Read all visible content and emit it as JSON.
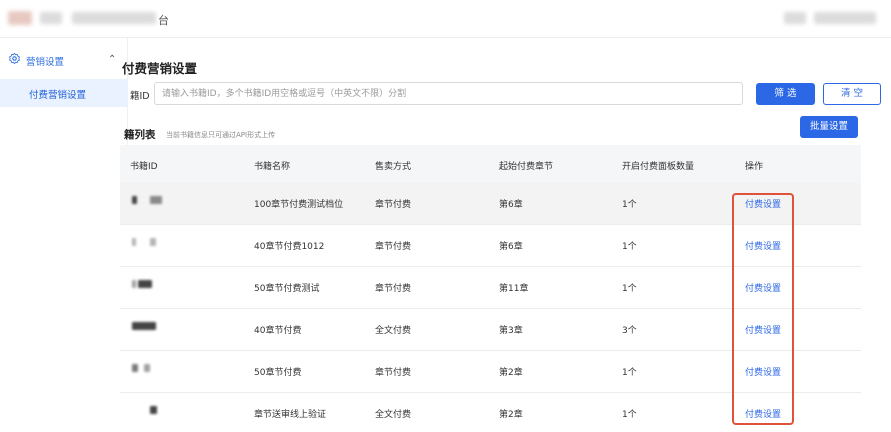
{
  "header": {
    "title_tail": "台"
  },
  "sidebar": {
    "group_label": "营销设置",
    "sub_item_label": "付费营销设置"
  },
  "page": {
    "title": "付费营销设置"
  },
  "filter": {
    "label": "籍ID",
    "placeholder": "请输入书籍ID，多个书籍ID用空格或逗号（中英文不限）分割",
    "value": "",
    "filter_button": "筛 选",
    "clear_button": "清 空"
  },
  "section": {
    "title": "籍列表",
    "subtitle": "当前书籍信息只可通过API形式上传",
    "batch_button": "批量设置"
  },
  "table": {
    "headers": [
      "书籍ID",
      "书籍名称",
      "售卖方式",
      "起始付费章节",
      "开启付费面板数量",
      "操作"
    ],
    "rows": [
      {
        "name": "100章节付费测试档位",
        "sale": "章节付费",
        "start": "第6章",
        "count": "1个",
        "action": "付费设置"
      },
      {
        "name": "40章节付费1012",
        "sale": "章节付费",
        "start": "第6章",
        "count": "1个",
        "action": "付费设置"
      },
      {
        "name": "50章节付费测试",
        "sale": "章节付费",
        "start": "第11章",
        "count": "1个",
        "action": "付费设置"
      },
      {
        "name": "40章节付费",
        "sale": "全文付费",
        "start": "第3章",
        "count": "3个",
        "action": "付费设置"
      },
      {
        "name": "50章节付费",
        "sale": "章节付费",
        "start": "第2章",
        "count": "1个",
        "action": "付费设置"
      },
      {
        "name": "章节送审线上验证",
        "sale": "全文付费",
        "start": "第2章",
        "count": "1个",
        "action": "付费设置"
      }
    ]
  },
  "colors": {
    "accent": "#2c67e6",
    "highlight": "#e0533b",
    "active_bg": "#eaf2ff"
  },
  "icons": {
    "menu": "gear-icon",
    "collapse": "chevron-up-icon"
  }
}
